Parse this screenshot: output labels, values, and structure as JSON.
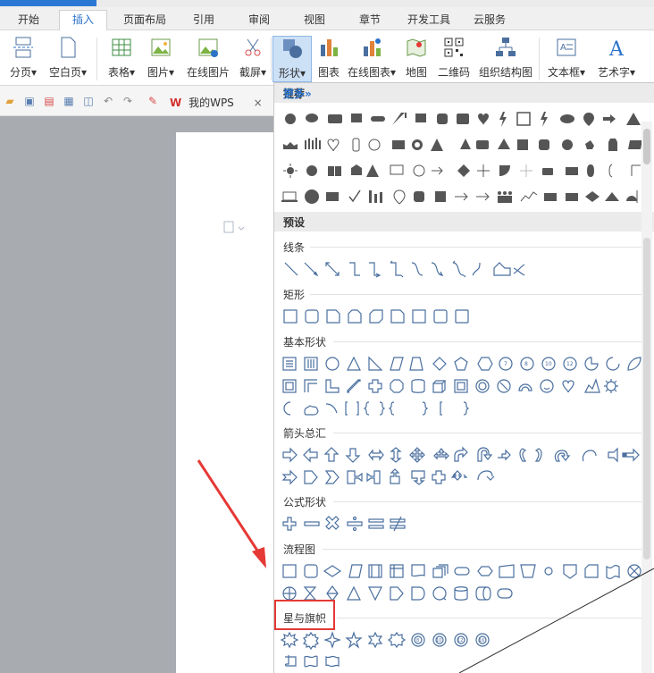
{
  "tabs": [
    "开始",
    "插入",
    "页面布局",
    "引用",
    "审阅",
    "视图",
    "章节",
    "开发工具",
    "云服务"
  ],
  "active_tab": "插入",
  "ribbon": {
    "page_break": "分页",
    "blank_page": "空白页",
    "table": "表格",
    "picture": "图片",
    "online_picture": "在线图片",
    "screenshot": "截屏",
    "shapes": "形状",
    "chart": "图表",
    "online_chart": "在线图表",
    "map": "地图",
    "qrcode": "二维码",
    "org_chart": "组织结构图",
    "textbox": "文本框",
    "wordart": "艺术字",
    "dropdown_glyph": "▾"
  },
  "doc_tab": {
    "brand": "W",
    "title": "我的WPS",
    "close": "×"
  },
  "shapes_panel": {
    "recommended": "推荐",
    "more": "更多»",
    "presets": "预设",
    "categories": [
      "线条",
      "矩形",
      "基本形状",
      "箭头总汇",
      "公式形状",
      "流程图",
      "星与旗帜"
    ]
  },
  "colors": {
    "accent": "#2b72c9",
    "highlight": "#e53935",
    "icon_stroke": "#4a6f9f"
  }
}
